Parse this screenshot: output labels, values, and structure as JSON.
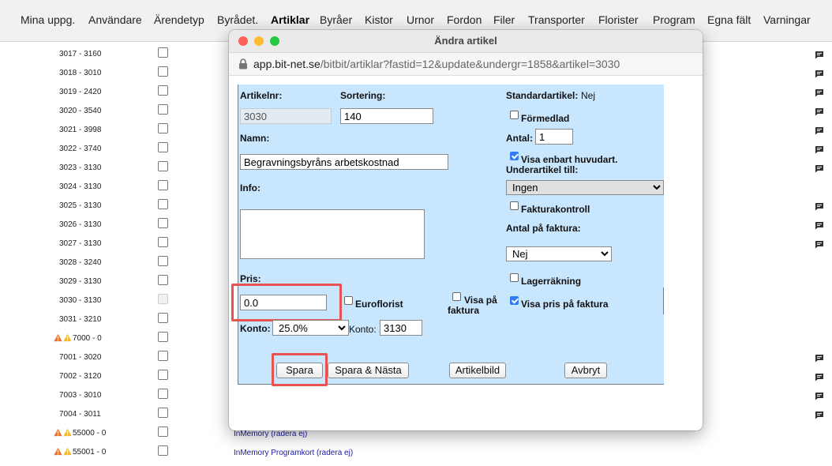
{
  "nav": {
    "items": [
      "Mina uppg.",
      "Användare",
      "Ärendetyp",
      "Byrådet.",
      "Artiklar",
      "Byråer",
      "Kistor",
      "Urnor",
      "Fordon",
      "Filer",
      "Transporter",
      "Florister",
      "Program",
      "Egna fält",
      "Varningar"
    ],
    "active": "Artiklar"
  },
  "list": {
    "rows": [
      {
        "id": "3017 - 3160",
        "note": true
      },
      {
        "id": "3018 - 3010",
        "note": true
      },
      {
        "id": "3019 - 2420",
        "note": true
      },
      {
        "id": "3020 - 3540",
        "note": true
      },
      {
        "id": "3021 - 3998",
        "note": true
      },
      {
        "id": "3022 - 3740",
        "note": true
      },
      {
        "id": "3023 - 3130",
        "note": true
      },
      {
        "id": "3024 - 3130",
        "note": false
      },
      {
        "id": "3025 - 3130",
        "note": true
      },
      {
        "id": "3026 - 3130",
        "note": true
      },
      {
        "id": "3027 - 3130",
        "note": true
      },
      {
        "id": "3028 - 3240",
        "note": false
      },
      {
        "id": "3029 - 3130",
        "note": false
      },
      {
        "id": "3030 - 3130",
        "note": false,
        "dim": true
      },
      {
        "id": "3031 - 3210",
        "note": false
      },
      {
        "id": "7000 - 0",
        "note": false,
        "warn": true
      },
      {
        "id": "7001 - 3020",
        "note": true
      },
      {
        "id": "7002 - 3120",
        "note": true
      },
      {
        "id": "7003 - 3010",
        "note": true
      },
      {
        "id": "7004 - 3011",
        "note": true
      },
      {
        "id": "55000 - 0",
        "note": false,
        "warn": true,
        "link": "InMemory (radera ej)"
      },
      {
        "id": "55001 - 0",
        "note": false,
        "warn": true,
        "link": "InMemory Programkort (radera ej)"
      }
    ]
  },
  "dialog": {
    "title": "Ändra artikel",
    "url_domain": "app.bit-net.se",
    "url_path": "/bitbit/artiklar?fastid=12&update&undergr=1858&artikel=3030"
  },
  "form": {
    "artikelnr_label": "Artikelnr:",
    "artikelnr_value": "3030",
    "sortering_label": "Sortering:",
    "sortering_value": "140",
    "namn_label": "Namn:",
    "namn_value": "Begravningsbyråns arbetskostnad",
    "info_label": "Info:",
    "info_value": "",
    "pris_label": "Pris:",
    "pris_value": "0.0",
    "euroflorist_label": "Euroflorist",
    "euroflorist_checked": false,
    "visa_pa_faktura_label_1": "Visa på",
    "visa_pa_faktura_label_2": "faktura",
    "visa_pa_faktura_checked": false,
    "konto_label": "Konto:",
    "moms_value": "25.0%",
    "konto2_label": "Konto:",
    "konto_value": "3130",
    "standardartikel_label": "Standardartikel:",
    "standardartikel_value": "Nej",
    "formedlad_label": "Förmedlad",
    "formedlad_checked": false,
    "antal_label": "Antal:",
    "antal_value": "1",
    "visa_enbart_label": "Visa enbart huvudart.",
    "visa_enbart_checked": true,
    "underartikel_label": "Underartikel till:",
    "underartikel_value": "Ingen",
    "fakturakontroll_label": "Fakturakontroll",
    "fakturakontroll_checked": false,
    "antal_pa_faktura_label": "Antal på faktura:",
    "antal_pa_faktura_value": "Nej",
    "lagerrakning_label": "Lagerräkning",
    "lagerrakning_checked": false,
    "visa_pris_label": "Visa pris på faktura",
    "visa_pris_checked": true
  },
  "buttons": {
    "spara": "Spara",
    "spara_nasta": "Spara & Nästa",
    "artikelbild": "Artikelbild",
    "avbryt": "Avbryt"
  },
  "colors": {
    "form_bg": "#c9e6ff",
    "highlight": "#e8534f",
    "link": "#1a1aa6",
    "check_on": "#2f7cf6"
  }
}
